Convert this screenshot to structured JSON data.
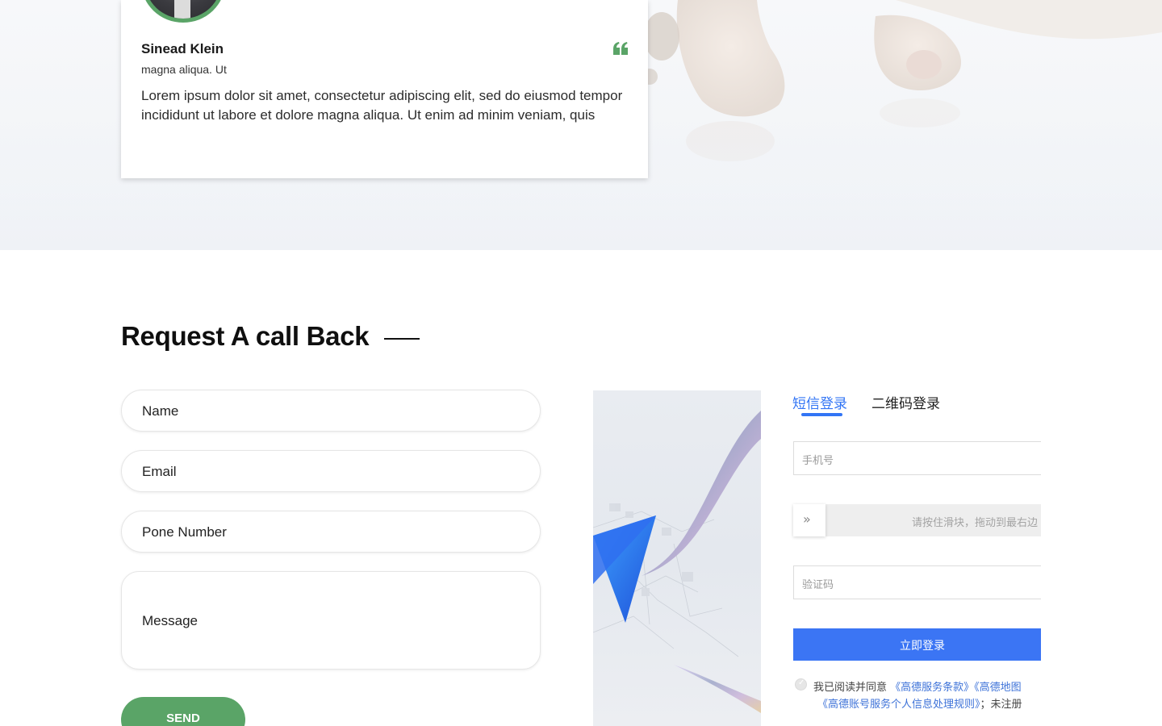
{
  "testimonial": {
    "name": "Sinead Klein",
    "role": "magna aliqua. Ut",
    "body": "Lorem ipsum dolor sit amet, consectetur adipiscing elit, sed do eiusmod tempor incididunt ut labore et dolore magna aliqua. Ut enim ad minim veniam, quis",
    "accent_color": "#5aa467"
  },
  "request": {
    "title": "Request A call Back",
    "fields": {
      "name": "Name",
      "email": "Email",
      "phone": "Pone Number",
      "message": "Message"
    },
    "send_label": "SEND",
    "button_color": "#5aa467"
  },
  "login": {
    "tabs": {
      "sms": "短信登录",
      "qr": "二维码登录"
    },
    "active_tab": "sms",
    "phone_placeholder": "手机号",
    "slider_hint": "请按住滑块，拖动到最右边",
    "code_placeholder": "验证码",
    "submit_label": "立即登录",
    "agree": {
      "prefix": "我已阅读并同意",
      "terms": "《高德服务条款》",
      "map": "《高德地图",
      "privacy": "《高德账号服务个人信息处理规则》",
      "suffix": "；未注册"
    },
    "accent_color": "#3275f5"
  }
}
